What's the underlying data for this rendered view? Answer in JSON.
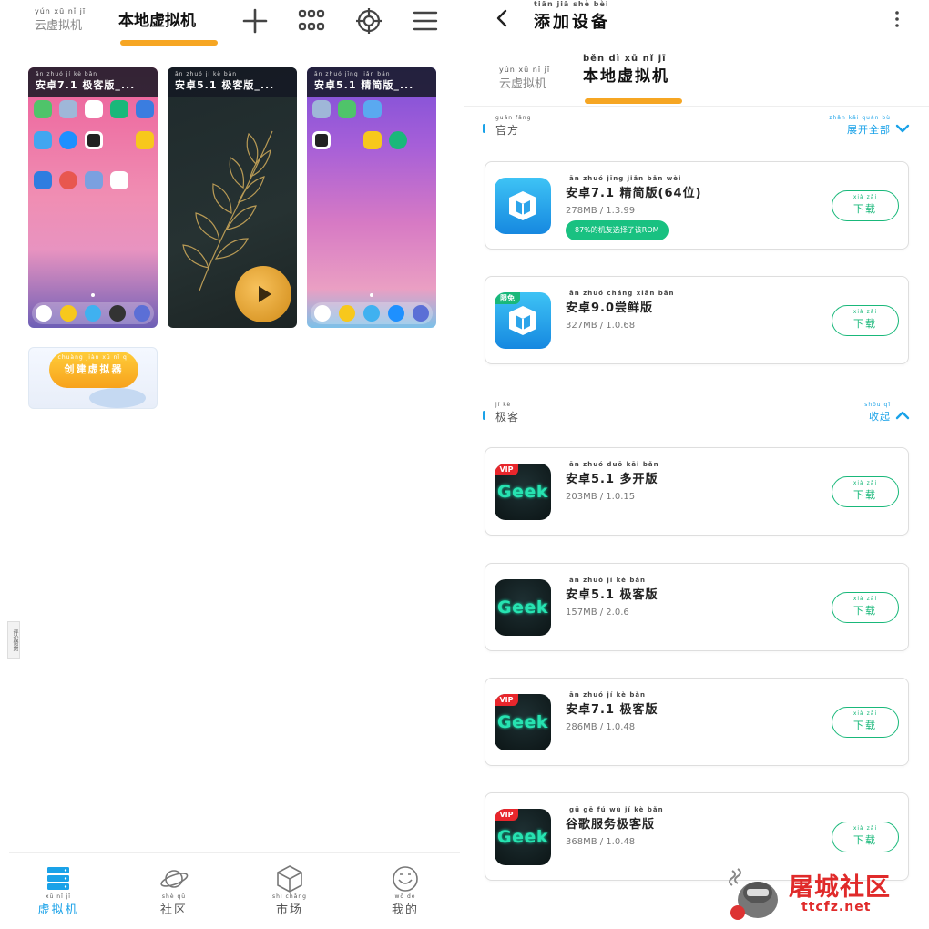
{
  "left": {
    "tabs": {
      "cloud": {
        "label": "云虚拟机",
        "pinyin": "yún xū nǐ jī"
      },
      "local": {
        "label": "本地虚拟机"
      }
    },
    "toolbar_icons": [
      "plus-icon",
      "grid-icon",
      "target-icon",
      "menu-icon"
    ],
    "vms": [
      {
        "title": "安卓7.1 极客版_...",
        "pinyin": "ān zhuó      jí kè bǎn"
      },
      {
        "title": "安卓5.1 极客版_...",
        "pinyin": "ān zhuó      jí kè bǎn"
      },
      {
        "title": "安卓5.1 精简版_...",
        "pinyin": "ān zhuó    jīng jiǎn bǎn"
      }
    ],
    "create": {
      "label": "创建虚拟器",
      "pinyin": "chuàng jiàn xū nǐ qì"
    },
    "side_note": "评论赞赏",
    "bottom_nav": [
      {
        "label": "虚拟机",
        "pinyin": "xū nǐ jī",
        "icon": "server-icon",
        "active": true
      },
      {
        "label": "社区",
        "pinyin": "shè qū",
        "icon": "planet-icon",
        "active": false
      },
      {
        "label": "市场",
        "pinyin": "shì chǎng",
        "icon": "cube-icon",
        "active": false
      },
      {
        "label": "我的",
        "pinyin": "wǒ de",
        "icon": "smile-icon",
        "active": false
      }
    ]
  },
  "right": {
    "header": {
      "title": "添加设备",
      "pinyin": "tiān jiā shè bèi"
    },
    "tabs": {
      "cloud": {
        "label": "云虚拟机",
        "pinyin": "yún xū nǐ jī"
      },
      "local": {
        "label": "本地虚拟机",
        "pinyin": "běn dì xū nǐ jī"
      }
    },
    "sections": [
      {
        "title": "官方",
        "pinyin": "guān fāng",
        "action": "展开全部",
        "action_pinyin": "zhǎn kāi quán bù",
        "expanded": false
      },
      {
        "title": "极客",
        "pinyin": "jí kè",
        "action": "收起",
        "action_pinyin": "shōu qǐ",
        "expanded": true
      }
    ],
    "devices": [
      {
        "name": "安卓7.1 精简版(64位)",
        "pinyin": "ān zhuó       jīng jiǎn bǎn      wèi",
        "meta": "278MB / 1.3.99",
        "tag": "87%的机友选择了该ROM",
        "badge": "",
        "icon": "vm-blue-icon"
      },
      {
        "name": "安卓9.0尝鲜版",
        "pinyin": "ān zhuó        cháng xiān bǎn",
        "meta": "327MB / 1.0.68",
        "tag": "",
        "badge": "限免",
        "icon": "vm-blue-icon"
      },
      {
        "name": "安卓5.1 多开版",
        "pinyin": "ān zhuó        duō kāi bǎn",
        "meta": "203MB / 1.0.15",
        "tag": "",
        "badge": "VIP",
        "icon": "geek-icon"
      },
      {
        "name": "安卓5.1 极客版",
        "pinyin": "ān zhuó          jí kè bǎn",
        "meta": "157MB / 2.0.6",
        "tag": "",
        "badge": "",
        "icon": "geek-icon"
      },
      {
        "name": "安卓7.1 极客版",
        "pinyin": "ān zhuó          jí kè bǎn",
        "meta": "286MB / 1.0.48",
        "tag": "",
        "badge": "VIP",
        "icon": "geek-icon"
      },
      {
        "name": "谷歌服务极客版",
        "pinyin": "gǔ gē fú wù jí kè bǎn",
        "meta": "368MB / 1.0.48",
        "tag": "",
        "badge": "VIP",
        "icon": "geek-icon"
      }
    ],
    "download_label": "下载",
    "download_pinyin": "xià zǎi",
    "geek_logo": {
      "prefix": "Gee",
      "suffix": "k"
    }
  },
  "watermark": {
    "main": "屠城社区",
    "sub": "ttcfz.net"
  },
  "colors": {
    "accent": "#1aa2e8",
    "underline": "#f6a623",
    "green": "#19b87a",
    "vip": "#e8262c"
  }
}
